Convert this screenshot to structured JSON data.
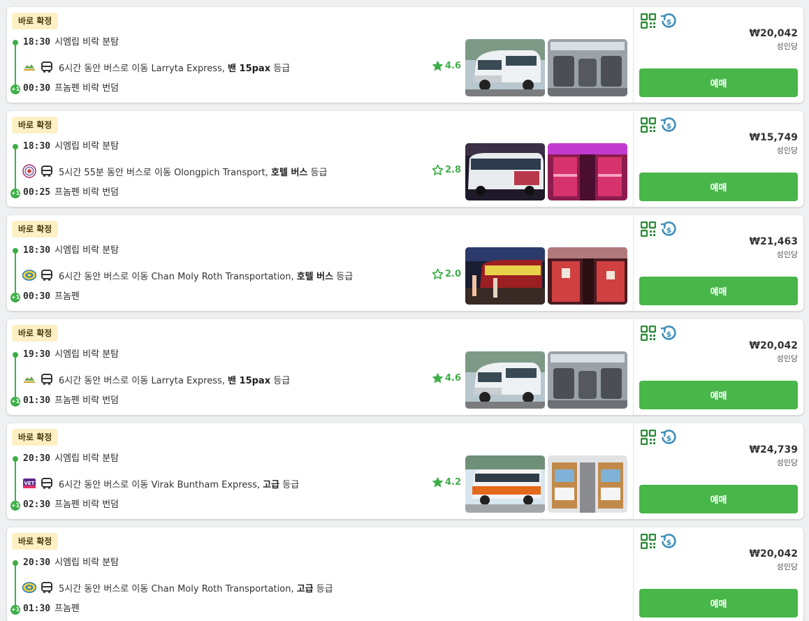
{
  "results": [
    {
      "badge": "바로 확정",
      "dep_time": "18:30",
      "dep_place": "시엠립 비락 분탐",
      "duration": "6시간 동안 버스로 이동 Larryta Express,",
      "class": "밴 15pax",
      "class_suffix": "등급",
      "operator_logo": "larryta-logo",
      "rating": "4.6",
      "arr_time": "00:30",
      "arr_place": "프놈펜 비락 번덤",
      "day_offset": "+1",
      "price": "₩20,042",
      "per": "성인당",
      "button": "예매",
      "photos": [
        "van-exterior",
        "van-interior"
      ]
    },
    {
      "badge": "바로 확정",
      "dep_time": "18:30",
      "dep_place": "시엠립 비락 분탐",
      "duration": "5시간 55분 동안 버스로 이동 Olongpich Transport,",
      "class": "호텔 버스",
      "class_suffix": "등급",
      "operator_logo": "olongpich-logo",
      "rating": "2.8",
      "arr_time": "00:25",
      "arr_place": "프놈펜 비락 번덤",
      "day_offset": "+1",
      "price": "₩15,749",
      "per": "성인당",
      "button": "예매",
      "photos": [
        "bus-night-exterior",
        "bus-purple-interior"
      ]
    },
    {
      "badge": "바로 확정",
      "dep_time": "18:30",
      "dep_place": "시엠립 비락 분탐",
      "duration": "6시간 동안 버스로 이동 Chan Moly Roth Transportation,",
      "class": "호텔 버스",
      "class_suffix": "등급",
      "operator_logo": "chan-moly-roth-logo",
      "rating": "2.0",
      "arr_time": "00:30",
      "arr_place": "프놈펜",
      "day_offset": "+1",
      "price": "₩21,463",
      "per": "성인당",
      "button": "예매",
      "photos": [
        "sleeper-bus-night",
        "sleeper-bus-interior-red"
      ]
    },
    {
      "badge": "바로 확정",
      "dep_time": "19:30",
      "dep_place": "시엠립 비락 분탐",
      "duration": "6시간 동안 버스로 이동 Larryta Express,",
      "class": "밴 15pax",
      "class_suffix": "등급",
      "operator_logo": "larryta-logo",
      "rating": "4.6",
      "arr_time": "01:30",
      "arr_place": "프놈펜 비락 번덤",
      "day_offset": "+1",
      "price": "₩20,042",
      "per": "성인당",
      "button": "예매",
      "photos": [
        "van-exterior",
        "van-interior"
      ]
    },
    {
      "badge": "바로 확정",
      "dep_time": "20:30",
      "dep_place": "시엠립 비락 분탐",
      "duration": "6시간 동안 버스로 이동 Virak Buntham Express,",
      "class": "고급",
      "class_suffix": "등급",
      "operator_logo": "virak-buntham-logo",
      "rating": "4.2",
      "arr_time": "02:30",
      "arr_place": "프놈펜 비락 번덤",
      "day_offset": "+1",
      "price": "₩24,739",
      "per": "성인당",
      "button": "예매",
      "photos": [
        "orange-bus-exterior",
        "sleeper-bunk-interior"
      ]
    },
    {
      "badge": "바로 확정",
      "dep_time": "20:30",
      "dep_place": "시엠립 비락 분탐",
      "duration": "5시간 동안 버스로 이동 Chan Moly Roth Transportation,",
      "class": "고급",
      "class_suffix": "등급",
      "operator_logo": "chan-moly-roth-logo",
      "rating": "",
      "arr_time": "01:30",
      "arr_place": "프놈펜",
      "day_offset": "+1",
      "price": "₩20,042",
      "per": "성인당",
      "button": "예매",
      "photos": []
    }
  ],
  "colors": {
    "accent_green": "#48b649",
    "badge_bg": "#fdf0c4",
    "refund_icon_blue": "#3a8fb7"
  }
}
